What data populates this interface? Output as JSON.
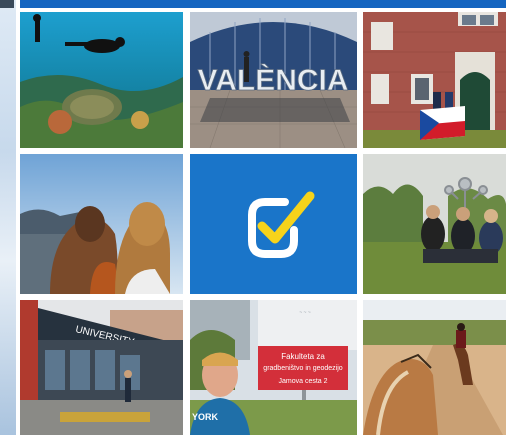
{
  "gallery": {
    "tiles": [
      {
        "name": "scuba-diving-photo",
        "label": ""
      },
      {
        "name": "valencia-sign-photo",
        "sign_text": "VALÈNCIA"
      },
      {
        "name": "brick-building-flag-photo",
        "label": ""
      },
      {
        "name": "friends-overlooking-city-photo",
        "label": ""
      },
      {
        "name": "checkmark-logo-tile",
        "accent": "#1a75c9",
        "check_color": "#f6d31b"
      },
      {
        "name": "group-in-park-photo",
        "label": ""
      },
      {
        "name": "university-building-photo",
        "sign_text": "UNIVERSITY OF STRATHCLYDE"
      },
      {
        "name": "faculty-sign-selfie-photo",
        "sign_line1": "Fakulteta za",
        "sign_line2": "gradbeništvo in geodezijo",
        "sign_line3": "Jamova cesta 2",
        "brand_text": "YORK"
      },
      {
        "name": "horse-riding-photo",
        "label": ""
      }
    ]
  },
  "colors": {
    "top_bar": "#1565c0",
    "logo_bg": "#1a75c9",
    "sign_red": "#d32f3a"
  }
}
